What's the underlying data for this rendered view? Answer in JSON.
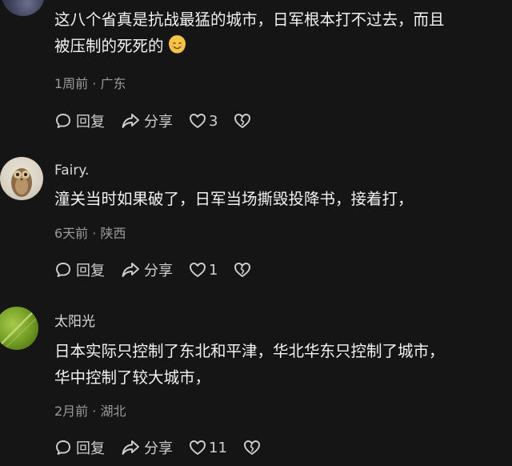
{
  "comments": [
    {
      "username": "",
      "text_line1": "这八个省真是抗战最猛的城市，日军根本打不过去，而且",
      "text_line2": "被压制的死死的",
      "emoji": "smile-face-icon",
      "time": "1周前",
      "location": "广东",
      "reply_label": "回复",
      "share_label": "分享",
      "likes": "3"
    },
    {
      "username": "Fairy.",
      "text_line1": "潼关当时如果破了，日军当场撕毁投降书，接着打，",
      "time": "6天前",
      "location": "陕西",
      "reply_label": "回复",
      "share_label": "分享",
      "likes": "1"
    },
    {
      "username": "太阳光",
      "text_line1": "日本实际只控制了东北和平津，华北华东只控制了城市，",
      "text_line2": "华中控制了较大城市，",
      "time": "2月前",
      "location": "湖北",
      "reply_label": "回复",
      "share_label": "分享",
      "likes": "11"
    }
  ],
  "separator": "·"
}
